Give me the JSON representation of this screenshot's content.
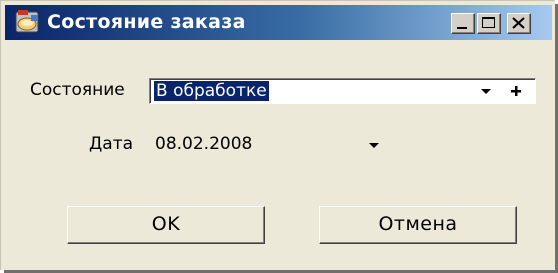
{
  "window": {
    "title": "Состояние заказа",
    "icon": "app-window-icon",
    "controls": {
      "minimize_icon": "minimize-icon",
      "maximize_icon": "maximize-icon",
      "close_icon": "close-icon"
    }
  },
  "form": {
    "state_label": "Состояние",
    "state_value": "В обработке",
    "state_dropdown_icon": "chevron-down-icon",
    "state_add_icon": "plus-icon",
    "date_label": "Дата",
    "date_value": "08.02.2008",
    "date_dropdown_icon": "chevron-down-icon"
  },
  "buttons": {
    "ok_label": "OK",
    "cancel_label": "Отмена"
  },
  "colors": {
    "title_gradient_start": "#0a246a",
    "title_gradient_end": "#a6caf0",
    "dialog_background": "#ece9d8",
    "selection_background": "#0a246a",
    "selection_text": "#ffffff"
  }
}
